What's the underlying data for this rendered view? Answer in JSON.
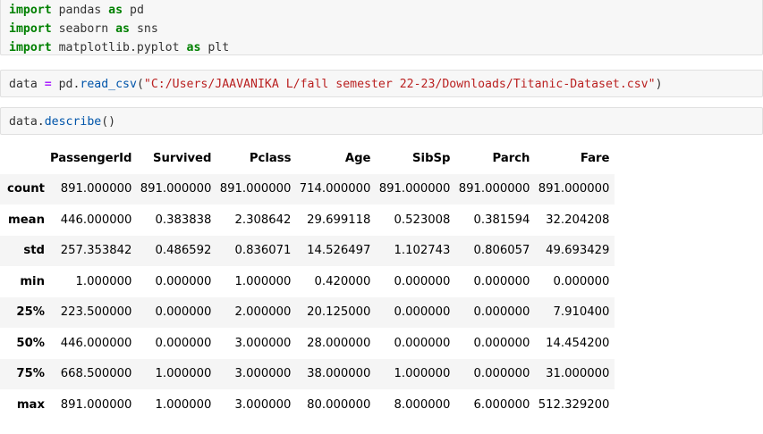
{
  "cells": {
    "imports": [
      {
        "kw1": "import",
        "mod": " pandas ",
        "kw2": "as",
        "alias": " pd"
      },
      {
        "kw1": "import",
        "mod": " seaborn ",
        "kw2": "as",
        "alias": " sns"
      },
      {
        "kw1": "import",
        "mod": " matplotlib.pyplot ",
        "kw2": "as",
        "alias": " plt"
      }
    ],
    "read": {
      "var": "data ",
      "op": "=",
      "obj": " pd.",
      "fn": "read_csv",
      "open": "(",
      "path": "\"C:/Users/JAAVANIKA L/fall semester 22-23/Downloads/Titanic-Dataset.csv\"",
      "close": ")"
    },
    "describe": {
      "obj": "data.",
      "fn": "describe",
      "args": "()"
    }
  },
  "table": {
    "columns": [
      "PassengerId",
      "Survived",
      "Pclass",
      "Age",
      "SibSp",
      "Parch",
      "Fare"
    ],
    "rows": [
      {
        "label": "count",
        "values": [
          "891.000000",
          "891.000000",
          "891.000000",
          "714.000000",
          "891.000000",
          "891.000000",
          "891.000000"
        ]
      },
      {
        "label": "mean",
        "values": [
          "446.000000",
          "0.383838",
          "2.308642",
          "29.699118",
          "0.523008",
          "0.381594",
          "32.204208"
        ]
      },
      {
        "label": "std",
        "values": [
          "257.353842",
          "0.486592",
          "0.836071",
          "14.526497",
          "1.102743",
          "0.806057",
          "49.693429"
        ]
      },
      {
        "label": "min",
        "values": [
          "1.000000",
          "0.000000",
          "1.000000",
          "0.420000",
          "0.000000",
          "0.000000",
          "0.000000"
        ]
      },
      {
        "label": "25%",
        "values": [
          "223.500000",
          "0.000000",
          "2.000000",
          "20.125000",
          "0.000000",
          "0.000000",
          "7.910400"
        ]
      },
      {
        "label": "50%",
        "values": [
          "446.000000",
          "0.000000",
          "3.000000",
          "28.000000",
          "0.000000",
          "0.000000",
          "14.454200"
        ]
      },
      {
        "label": "75%",
        "values": [
          "668.500000",
          "1.000000",
          "3.000000",
          "38.000000",
          "1.000000",
          "0.000000",
          "31.000000"
        ]
      },
      {
        "label": "max",
        "values": [
          "891.000000",
          "1.000000",
          "3.000000",
          "80.000000",
          "8.000000",
          "6.000000",
          "512.329200"
        ]
      }
    ]
  }
}
